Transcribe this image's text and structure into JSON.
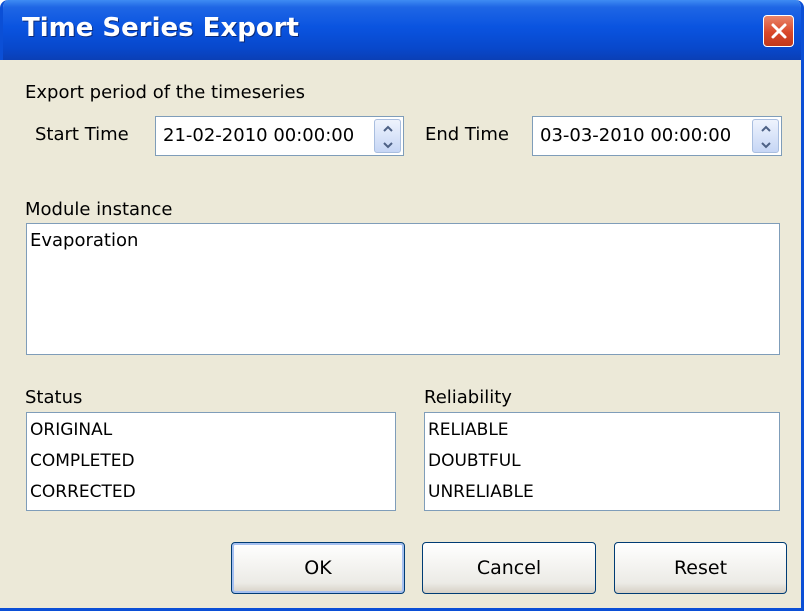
{
  "window": {
    "title": "Time Series Export"
  },
  "period": {
    "label": "Export period of the timeseries",
    "start_label": "Start Time",
    "start_value": "21-02-2010 00:00:00",
    "end_label": "End Time",
    "end_value": "03-03-2010 00:00:00"
  },
  "module": {
    "label": "Module instance",
    "items": [
      "Evaporation"
    ]
  },
  "status": {
    "label": "Status",
    "items": [
      "ORIGINAL",
      "COMPLETED",
      "CORRECTED"
    ]
  },
  "reliability": {
    "label": "Reliability",
    "items": [
      "RELIABLE",
      "DOUBTFUL",
      "UNRELIABLE"
    ]
  },
  "buttons": {
    "ok": "OK",
    "cancel": "Cancel",
    "reset": "Reset"
  },
  "icons": [
    "close-icon",
    "spin-up-icon",
    "spin-down-icon"
  ],
  "colors": {
    "titlebar": "#0a54e0",
    "close": "#d9482a",
    "dialog_bg": "#ece9d8"
  }
}
